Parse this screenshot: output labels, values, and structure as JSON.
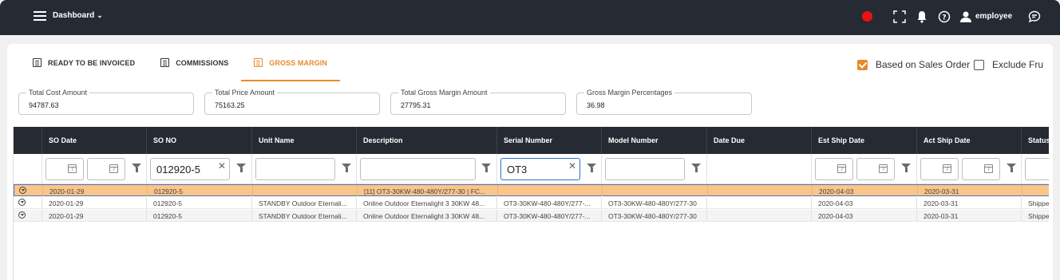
{
  "topbar": {
    "dashboard_label": "Dashboard",
    "user_name": "employee",
    "record_color": "#ee1111"
  },
  "tabs": [
    {
      "label": "READY TO BE INVOICED",
      "active": false
    },
    {
      "label": "COMMISSIONS",
      "active": false
    },
    {
      "label": "GROSS MARGIN",
      "active": true
    }
  ],
  "options": {
    "based_on_sales_order": {
      "label": "Based on Sales Order",
      "checked": true
    },
    "exclude": {
      "label": "Exclude Fru",
      "checked": false
    }
  },
  "summary": [
    {
      "label": "Total Cost Amount",
      "value": "94787.63"
    },
    {
      "label": "Total Price Amount",
      "value": "75163.25"
    },
    {
      "label": "Total Gross Margin Amount",
      "value": "27795.31"
    },
    {
      "label": "Gross Margin Percentages",
      "value": "36.98"
    }
  ],
  "grid": {
    "columns": [
      "SO Date",
      "SO NO",
      "Unit Name",
      "Description",
      "Serial Number",
      "Model Number",
      "Date Due",
      "Est Ship Date",
      "Act Ship Date",
      "Status"
    ],
    "filters": {
      "so_no": "012920-5",
      "serial_number": "OT3"
    },
    "rows": [
      [
        "2020-01-29",
        "012920-5",
        "",
        "[11] OT3-30KW-480-480Y/277-30 | FC...",
        "",
        "",
        "",
        "2020-04-03",
        "2020-03-31",
        ""
      ],
      [
        "2020-01-29",
        "012920-5",
        "STANDBY Outdoor Eternali...",
        "Online Outdoor Eternalight 3 30KW 48...",
        "OT3-30KW-480-480Y/277-...",
        "OT3-30KW-480-480Y/277-30",
        "",
        "2020-04-03",
        "2020-03-31",
        "Shippe"
      ],
      [
        "2020-01-29",
        "012920-5",
        "STANDBY Outdoor Eternali...",
        "Online Outdoor Eternalight 3 30KW 48...",
        "OT3-30KW-480-480Y/277-...",
        "OT3-30KW-480-480Y/277-30",
        "",
        "2020-04-03",
        "2020-03-31",
        "Shippe"
      ]
    ]
  },
  "colors": {
    "accent": "#e88a2a",
    "header_bg": "#262b33",
    "selected_row": "#fbc588"
  }
}
